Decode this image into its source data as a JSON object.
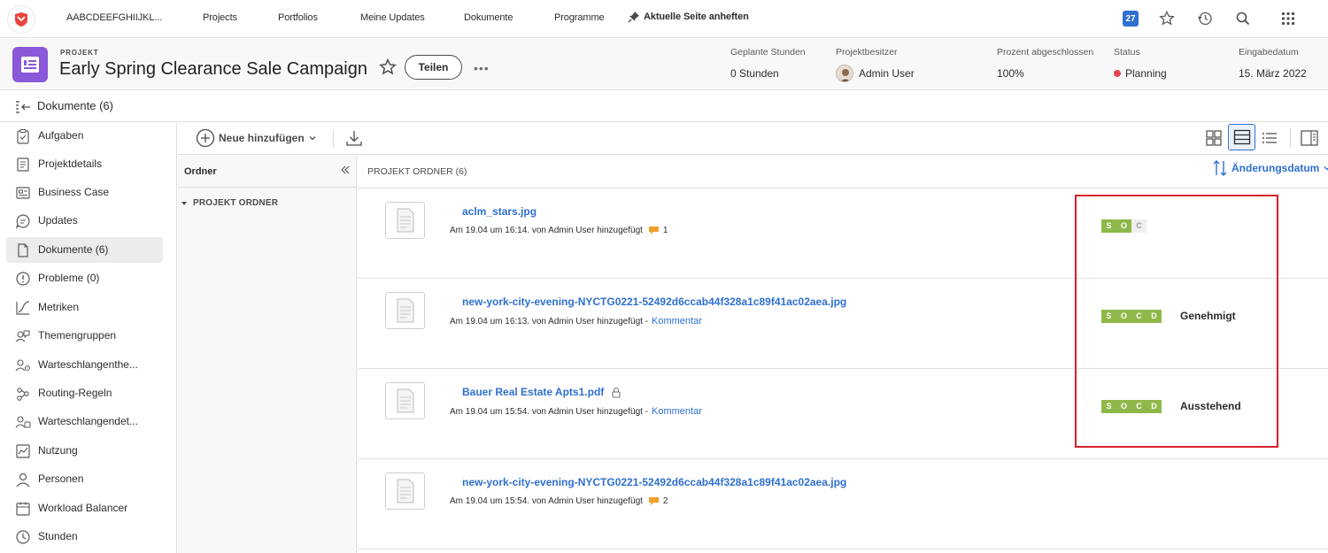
{
  "topnav": {
    "org": "AABCDEEFGHIIJKL...",
    "items": [
      "Projects",
      "Portfolios",
      "Meine Updates",
      "Dokumente",
      "Programme"
    ],
    "pin_label": "Aktuelle Seite anheften",
    "notification_count": "27"
  },
  "header": {
    "type_label": "PROJEKT",
    "title": "Early Spring Clearance Sale Campaign",
    "share_label": "Teilen",
    "more_label": "•••",
    "meta": [
      {
        "label": "Geplante Stunden",
        "value": "0 Stunden"
      },
      {
        "label": "Projektbesitzer",
        "value": "Admin User"
      },
      {
        "label": "Prozent abgeschlossen",
        "value": "100%"
      },
      {
        "label": "Status",
        "value": "Planning"
      },
      {
        "label": "Eingabedatum",
        "value": "15. März 2022"
      }
    ]
  },
  "docbar": {
    "title": "Dokumente (6)"
  },
  "sidebar": {
    "items": [
      {
        "label": "Aufgaben",
        "icon": "clipboard-check-icon"
      },
      {
        "label": "Projektdetails",
        "icon": "document-lines-icon"
      },
      {
        "label": "Business Case",
        "icon": "business-case-icon"
      },
      {
        "label": "Updates",
        "icon": "chat-bubble-icon"
      },
      {
        "label": "Dokumente (6)",
        "icon": "document-icon"
      },
      {
        "label": "Probleme (0)",
        "icon": "alert-circle-icon"
      },
      {
        "label": "Metriken",
        "icon": "chart-line-icon"
      },
      {
        "label": "Themengruppen",
        "icon": "chat-group-icon"
      },
      {
        "label": "Warteschlangenthe...",
        "icon": "queue-topic-icon"
      },
      {
        "label": "Routing-Regeln",
        "icon": "routing-icon"
      },
      {
        "label": "Warteschlangendet...",
        "icon": "queue-details-icon"
      },
      {
        "label": "Nutzung",
        "icon": "usage-chart-icon"
      },
      {
        "label": "Personen",
        "icon": "people-icon"
      },
      {
        "label": "Workload Balancer",
        "icon": "calendar-icon"
      },
      {
        "label": "Stunden",
        "icon": "clock-icon"
      }
    ]
  },
  "toolbar": {
    "add_label": "Neue hinzufügen"
  },
  "folders": {
    "header": "Ordner",
    "root": "PROJEKT ORDNER"
  },
  "main": {
    "folder_title": "PROJEKT ORDNER (6)",
    "sort_label": "Änderungsdatum",
    "documents": [
      {
        "name": "aclm_stars.jpg",
        "meta": "Am 19.04 um 16:14. von Admin User hinzugefügt",
        "comments": "1",
        "link": "",
        "approval": "",
        "socd": [
          "S",
          "O",
          "C"
        ]
      },
      {
        "name": "new-york-city-evening-NYCTG0221-52492d6ccab44f328a1c89f41ac02aea.jpg",
        "meta": "Am 19.04 um 16:13. von Admin User hinzugefügt -",
        "comments": "",
        "link": "Kommentar",
        "approval": "Genehmigt",
        "socd": [
          "S",
          "O",
          "C",
          "D"
        ]
      },
      {
        "name": "Bauer Real Estate Apts1.pdf",
        "meta": "Am 19.04 um 15:54. von Admin User hinzugefügt -",
        "comments": "",
        "link": "Kommentar",
        "approval": "Ausstehend",
        "socd": [
          "S",
          "O",
          "C",
          "D"
        ]
      },
      {
        "name": "new-york-city-evening-NYCTG0221-52492d6ccab44f328a1c89f41ac02aea.jpg",
        "meta": "Am 19.04 um 15:54. von Admin User hinzugefügt",
        "comments": "2",
        "link": "",
        "approval": "",
        "socd": []
      }
    ]
  },
  "colors": {
    "accent": "#2f6fd1",
    "brand": "#8a59d9",
    "proof_green": "#8fb84a",
    "highlight": "#d8202a",
    "status_red": "#e34850"
  }
}
